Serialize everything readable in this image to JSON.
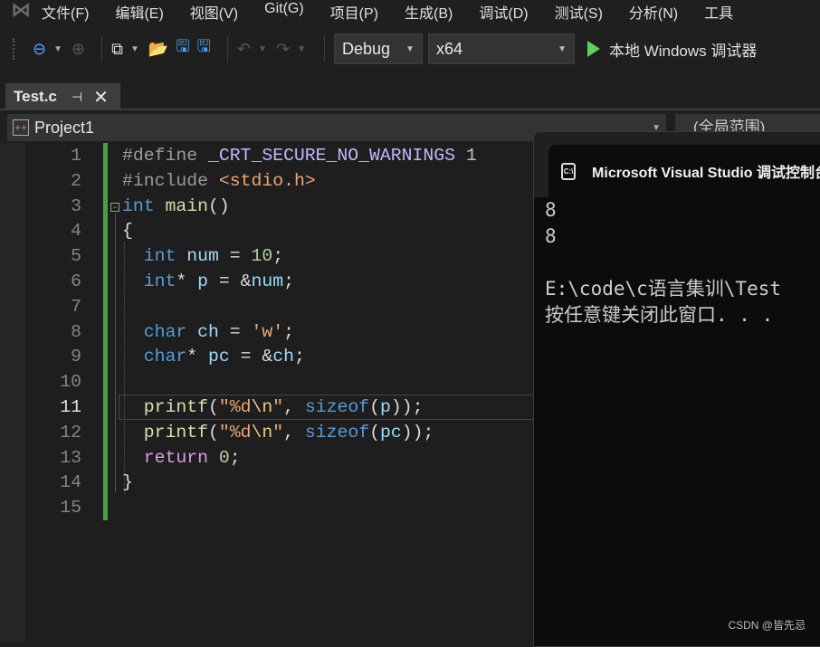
{
  "menu": [
    "文件(F)",
    "编辑(E)",
    "视图(V)",
    "Git(G)",
    "项目(P)",
    "生成(B)",
    "调试(D)",
    "测试(S)",
    "分析(N)",
    "工具"
  ],
  "toolbar": {
    "config": "Debug",
    "platform": "x64",
    "run_label": "本地 Windows 调试器",
    "accent": "#4aa3ff"
  },
  "tab": {
    "label": "Test.c",
    "pin": "⊣",
    "close": "✕"
  },
  "nav": {
    "project": "Project1",
    "scope": "(全局范围)"
  },
  "editor": {
    "current_line": 11,
    "lines": [
      [
        [
          "#define ",
          "pp"
        ],
        [
          "_CRT_SECURE_NO_WARNINGS",
          "mac"
        ],
        [
          " ",
          "pl"
        ],
        [
          "1",
          "num"
        ]
      ],
      [
        [
          "#include ",
          "pp"
        ],
        [
          "<stdio.h>",
          "str"
        ]
      ],
      [
        [
          "int",
          "kw"
        ],
        [
          " ",
          "pl"
        ],
        [
          "main",
          "fn"
        ],
        [
          "()",
          "pl"
        ]
      ],
      [
        [
          "{",
          "pl"
        ]
      ],
      [
        [
          "  ",
          "pl"
        ],
        [
          "int",
          "kw"
        ],
        [
          " ",
          "pl"
        ],
        [
          "num",
          "id"
        ],
        [
          " = ",
          "pl"
        ],
        [
          "10",
          "num"
        ],
        [
          ";",
          "pl"
        ]
      ],
      [
        [
          "  ",
          "pl"
        ],
        [
          "int",
          "kw"
        ],
        [
          "* ",
          "pl"
        ],
        [
          "p",
          "id"
        ],
        [
          " = &",
          "pl"
        ],
        [
          "num",
          "id"
        ],
        [
          ";",
          "pl"
        ]
      ],
      [],
      [
        [
          "  ",
          "pl"
        ],
        [
          "char",
          "kw"
        ],
        [
          " ",
          "pl"
        ],
        [
          "ch",
          "id"
        ],
        [
          " = ",
          "pl"
        ],
        [
          "'w'",
          "str"
        ],
        [
          ";",
          "pl"
        ]
      ],
      [
        [
          "  ",
          "pl"
        ],
        [
          "char",
          "kw"
        ],
        [
          "* ",
          "pl"
        ],
        [
          "pc",
          "id"
        ],
        [
          " = &",
          "pl"
        ],
        [
          "ch",
          "id"
        ],
        [
          ";",
          "pl"
        ]
      ],
      [],
      [
        [
          "  ",
          "pl"
        ],
        [
          "printf",
          "fn"
        ],
        [
          "(",
          "pl"
        ],
        [
          "\"%d",
          "str"
        ],
        [
          "\\n",
          "esc"
        ],
        [
          "\"",
          "str"
        ],
        [
          ", ",
          "pl"
        ],
        [
          "sizeof",
          "kw"
        ],
        [
          "(",
          "pl"
        ],
        [
          "p",
          "id"
        ],
        [
          "));",
          "pl"
        ]
      ],
      [
        [
          "  ",
          "pl"
        ],
        [
          "printf",
          "fn"
        ],
        [
          "(",
          "pl"
        ],
        [
          "\"%d",
          "str"
        ],
        [
          "\\n",
          "esc"
        ],
        [
          "\"",
          "str"
        ],
        [
          ", ",
          "pl"
        ],
        [
          "sizeof",
          "kw"
        ],
        [
          "(",
          "pl"
        ],
        [
          "pc",
          "id"
        ],
        [
          "));",
          "pl"
        ]
      ],
      [
        [
          "  ",
          "pl"
        ],
        [
          "return",
          "ctl"
        ],
        [
          " ",
          "pl"
        ],
        [
          "0",
          "num"
        ],
        [
          ";",
          "pl"
        ]
      ],
      [
        [
          "}",
          "pl"
        ]
      ],
      []
    ]
  },
  "console": {
    "title": "Microsoft Visual Studio 调试控制台",
    "icon": "C:\\",
    "output": "8\n8\n\nE:\\code\\c语言集训\\Test\n按任意键关闭此窗口. . ."
  },
  "watermark": "CSDN @皆先忌"
}
